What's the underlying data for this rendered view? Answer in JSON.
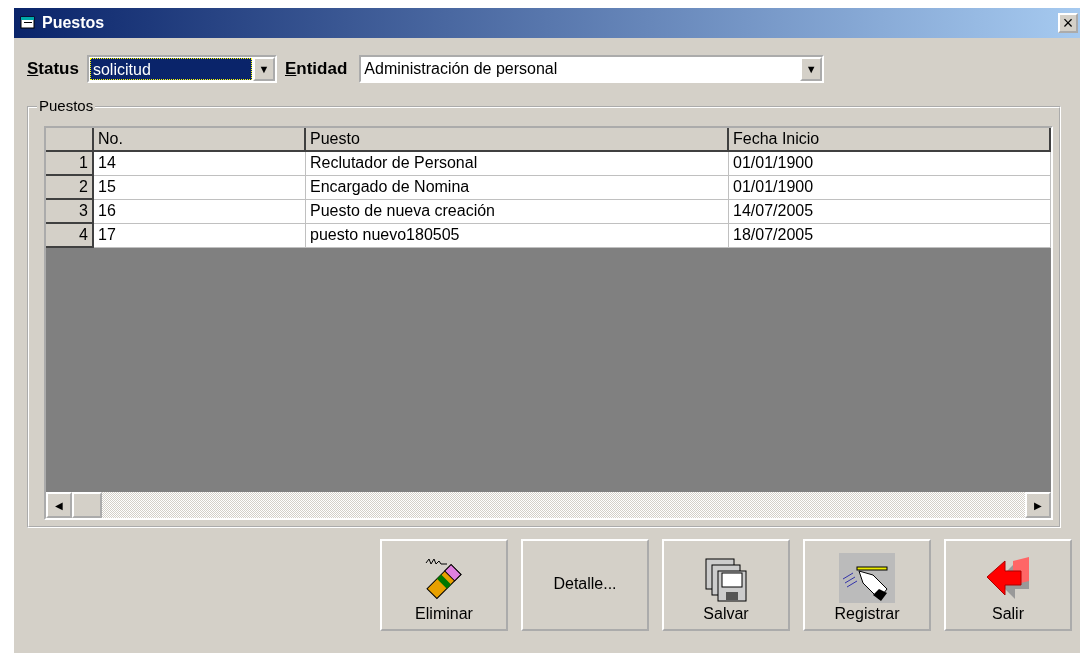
{
  "window": {
    "title": "Puestos",
    "close": "×"
  },
  "filters": [
    {
      "label": "Status",
      "value": "solicitud",
      "focused": true,
      "arrow": "▼"
    },
    {
      "label": "Entidad",
      "value": "Administración de personal",
      "focused": false,
      "arrow": "▼"
    }
  ],
  "group": {
    "title": "Puestos"
  },
  "table": {
    "columns": [
      "No.",
      "Puesto",
      "Fecha Inicio"
    ],
    "rows": [
      {
        "number": "1",
        "cells": [
          "14",
          "Reclutador de Personal",
          "01/01/1900"
        ]
      },
      {
        "number": "2",
        "cells": [
          "15",
          "Encargado de Nomina",
          "01/01/1900"
        ]
      },
      {
        "number": "3",
        "cells": [
          "16",
          "Puesto de nueva creación",
          "14/07/2005"
        ]
      },
      {
        "number": "4",
        "cells": [
          "17",
          "puesto nuevo180505",
          "18/07/2005"
        ]
      }
    ],
    "scroll_left": "◀",
    "scroll_right": "▶"
  },
  "buttons": [
    {
      "label": "Eliminar",
      "kind": "delete"
    },
    {
      "label": "Detalle...",
      "kind": "text"
    },
    {
      "label": "Salvar",
      "kind": "save"
    },
    {
      "label": "Registrar",
      "kind": "register"
    },
    {
      "label": "Salir",
      "kind": "exit"
    }
  ]
}
